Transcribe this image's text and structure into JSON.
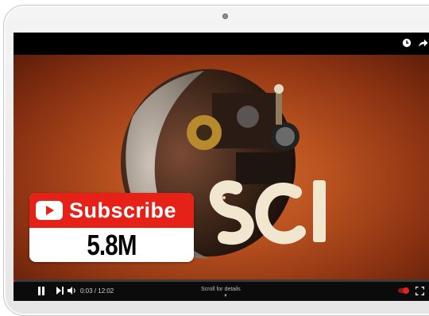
{
  "player": {
    "top_icons": [
      "clock-icon",
      "share-icon"
    ],
    "time_display": "0:03 / 12:02",
    "scroll_hint": "Scroll for details",
    "progress_fraction": 0.004,
    "accent_color": "#cc181e"
  },
  "subscribe_badge": {
    "label": "Subscribe",
    "count": "5.8M",
    "brand_color": "#e62117"
  }
}
